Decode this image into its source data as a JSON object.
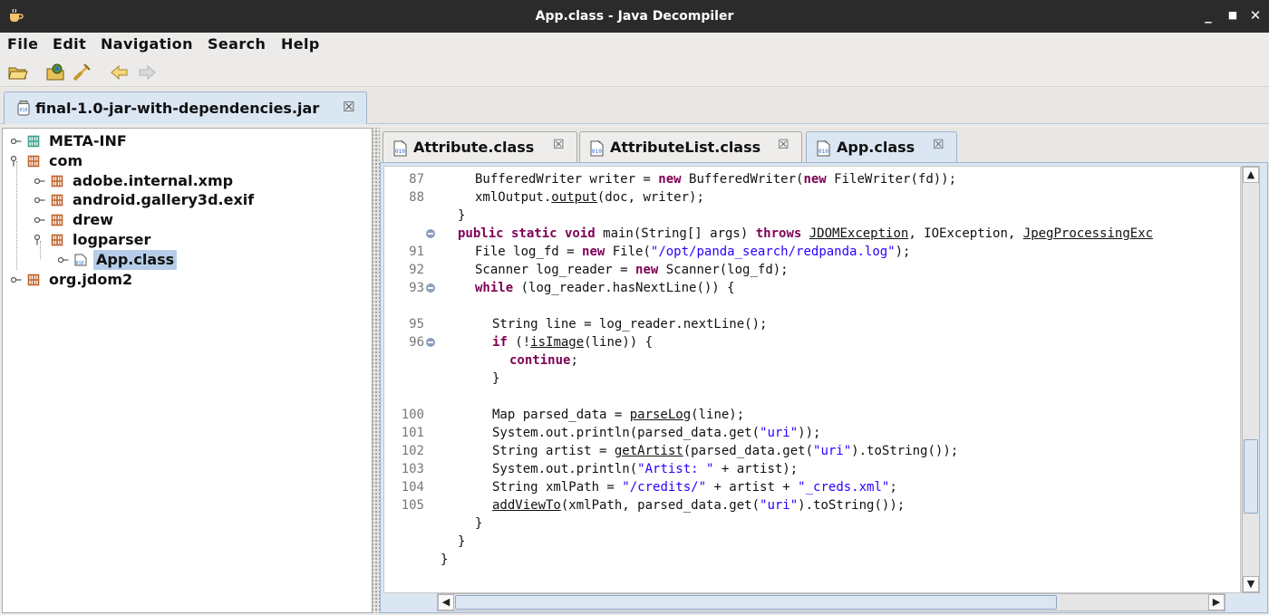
{
  "window": {
    "title": "App.class - Java Decompiler",
    "minimize": "_",
    "maximize": "■",
    "close": "✕"
  },
  "menu": [
    "File",
    "Edit",
    "Navigation",
    "Search",
    "Help"
  ],
  "toolbar": {
    "icons": [
      "open-folder-icon",
      "open-type-icon",
      "search-icon",
      "back-arrow-icon",
      "forward-arrow-icon"
    ]
  },
  "jar_tab": {
    "label": "final-1.0-jar-with-dependencies.jar",
    "close": "☒"
  },
  "tree": {
    "items": [
      {
        "label": "META-INF",
        "depth": 0,
        "icon": "package-icon",
        "expanded": false,
        "selected": false
      },
      {
        "label": "com",
        "depth": 0,
        "icon": "package-icon",
        "expanded": true,
        "selected": false
      },
      {
        "label": "adobe.internal.xmp",
        "depth": 1,
        "icon": "package-icon",
        "expanded": false,
        "selected": false
      },
      {
        "label": "android.gallery3d.exif",
        "depth": 1,
        "icon": "package-icon",
        "expanded": false,
        "selected": false
      },
      {
        "label": "drew",
        "depth": 1,
        "icon": "package-icon",
        "expanded": false,
        "selected": false
      },
      {
        "label": "logparser",
        "depth": 1,
        "icon": "package-icon",
        "expanded": true,
        "selected": false
      },
      {
        "label": "App.class",
        "depth": 2,
        "icon": "class-file-icon",
        "expanded": false,
        "selected": true
      },
      {
        "label": "org.jdom2",
        "depth": 0,
        "icon": "package-icon",
        "expanded": false,
        "selected": false
      }
    ]
  },
  "code_tabs": [
    {
      "label": "Attribute.class",
      "close": "☒",
      "active": false
    },
    {
      "label": "AttributeList.class",
      "close": "☒",
      "active": false
    },
    {
      "label": "App.class",
      "close": "☒",
      "active": true
    }
  ],
  "code": {
    "lines": [
      {
        "num": "87",
        "fold": false,
        "indent": 2,
        "tokens": [
          [
            "",
            "BufferedWriter writer = "
          ],
          [
            "kw",
            "new"
          ],
          [
            "",
            " BufferedWriter("
          ],
          [
            "kw",
            "new"
          ],
          [
            "",
            " FileWriter(fd));"
          ]
        ]
      },
      {
        "num": "88",
        "fold": false,
        "indent": 2,
        "tokens": [
          [
            "",
            "xmlOutput."
          ],
          [
            "ul",
            "output"
          ],
          [
            "",
            "(doc, writer);"
          ]
        ]
      },
      {
        "num": "",
        "fold": false,
        "indent": 1,
        "tokens": [
          [
            "",
            "}"
          ]
        ]
      },
      {
        "num": "",
        "fold": true,
        "indent": 1,
        "tokens": [
          [
            "kw",
            "public static void"
          ],
          [
            "",
            " main(String[] args) "
          ],
          [
            "kw",
            "throws"
          ],
          [
            "",
            " "
          ],
          [
            "ul",
            "JDOMException"
          ],
          [
            "",
            ", IOException, "
          ],
          [
            "ul",
            "JpegProcessingExc"
          ]
        ]
      },
      {
        "num": "91",
        "fold": false,
        "indent": 2,
        "tokens": [
          [
            "",
            "File log_fd = "
          ],
          [
            "kw",
            "new"
          ],
          [
            "",
            " File("
          ],
          [
            "str",
            "\"/opt/panda_search/redpanda.log\""
          ],
          [
            "",
            ");"
          ]
        ]
      },
      {
        "num": "92",
        "fold": false,
        "indent": 2,
        "tokens": [
          [
            "",
            "Scanner log_reader = "
          ],
          [
            "kw",
            "new"
          ],
          [
            "",
            " Scanner(log_fd);"
          ]
        ]
      },
      {
        "num": "93",
        "fold": true,
        "indent": 2,
        "tokens": [
          [
            "kw",
            "while"
          ],
          [
            "",
            " (log_reader.hasNextLine()) {"
          ]
        ]
      },
      {
        "num": "",
        "fold": false,
        "indent": 0,
        "tokens": []
      },
      {
        "num": "95",
        "fold": false,
        "indent": 3,
        "tokens": [
          [
            "",
            "String line = log_reader.nextLine();"
          ]
        ]
      },
      {
        "num": "96",
        "fold": true,
        "indent": 3,
        "tokens": [
          [
            "kw",
            "if"
          ],
          [
            "",
            " (!"
          ],
          [
            "ul",
            "isImage"
          ],
          [
            "",
            "(line)) {"
          ]
        ]
      },
      {
        "num": "",
        "fold": false,
        "indent": 4,
        "tokens": [
          [
            "kw",
            "continue"
          ],
          [
            "",
            ";"
          ]
        ]
      },
      {
        "num": "",
        "fold": false,
        "indent": 3,
        "tokens": [
          [
            "",
            "}"
          ]
        ]
      },
      {
        "num": "",
        "fold": false,
        "indent": 0,
        "tokens": []
      },
      {
        "num": "100",
        "fold": false,
        "indent": 3,
        "tokens": [
          [
            "",
            "Map parsed_data = "
          ],
          [
            "ul",
            "parseLog"
          ],
          [
            "",
            "(line);"
          ]
        ]
      },
      {
        "num": "101",
        "fold": false,
        "indent": 3,
        "tokens": [
          [
            "",
            "System.out.println(parsed_data.get("
          ],
          [
            "str",
            "\"uri\""
          ],
          [
            "",
            "));"
          ]
        ]
      },
      {
        "num": "102",
        "fold": false,
        "indent": 3,
        "tokens": [
          [
            "",
            "String artist = "
          ],
          [
            "ul",
            "getArtist"
          ],
          [
            "",
            "(parsed_data.get("
          ],
          [
            "str",
            "\"uri\""
          ],
          [
            "",
            ").toString());"
          ]
        ]
      },
      {
        "num": "103",
        "fold": false,
        "indent": 3,
        "tokens": [
          [
            "",
            "System.out.println("
          ],
          [
            "str",
            "\"Artist: \""
          ],
          [
            "",
            " + artist);"
          ]
        ]
      },
      {
        "num": "104",
        "fold": false,
        "indent": 3,
        "tokens": [
          [
            "",
            "String xmlPath = "
          ],
          [
            "str",
            "\"/credits/\""
          ],
          [
            "",
            " + artist + "
          ],
          [
            "str",
            "\"_creds.xml\""
          ],
          [
            "",
            ";"
          ]
        ]
      },
      {
        "num": "105",
        "fold": false,
        "indent": 3,
        "tokens": [
          [
            "ul",
            "addViewTo"
          ],
          [
            "",
            "(xmlPath, parsed_data.get("
          ],
          [
            "str",
            "\"uri\""
          ],
          [
            "",
            ").toString());"
          ]
        ]
      },
      {
        "num": "",
        "fold": false,
        "indent": 2,
        "tokens": [
          [
            "",
            "}"
          ]
        ]
      },
      {
        "num": "",
        "fold": false,
        "indent": 1,
        "tokens": [
          [
            "",
            "}"
          ]
        ]
      },
      {
        "num": "",
        "fold": false,
        "indent": 0,
        "tokens": [
          [
            "",
            "}"
          ]
        ]
      }
    ]
  },
  "scroll": {
    "vertical_position": 0.8,
    "horizontal_position": 0.0,
    "horizontal_visible_fraction": 0.8
  },
  "colors": {
    "keyword": "#7f0055",
    "string": "#2a00ff",
    "selection": "#b5cde8",
    "active_tab": "#dbe6f3"
  }
}
